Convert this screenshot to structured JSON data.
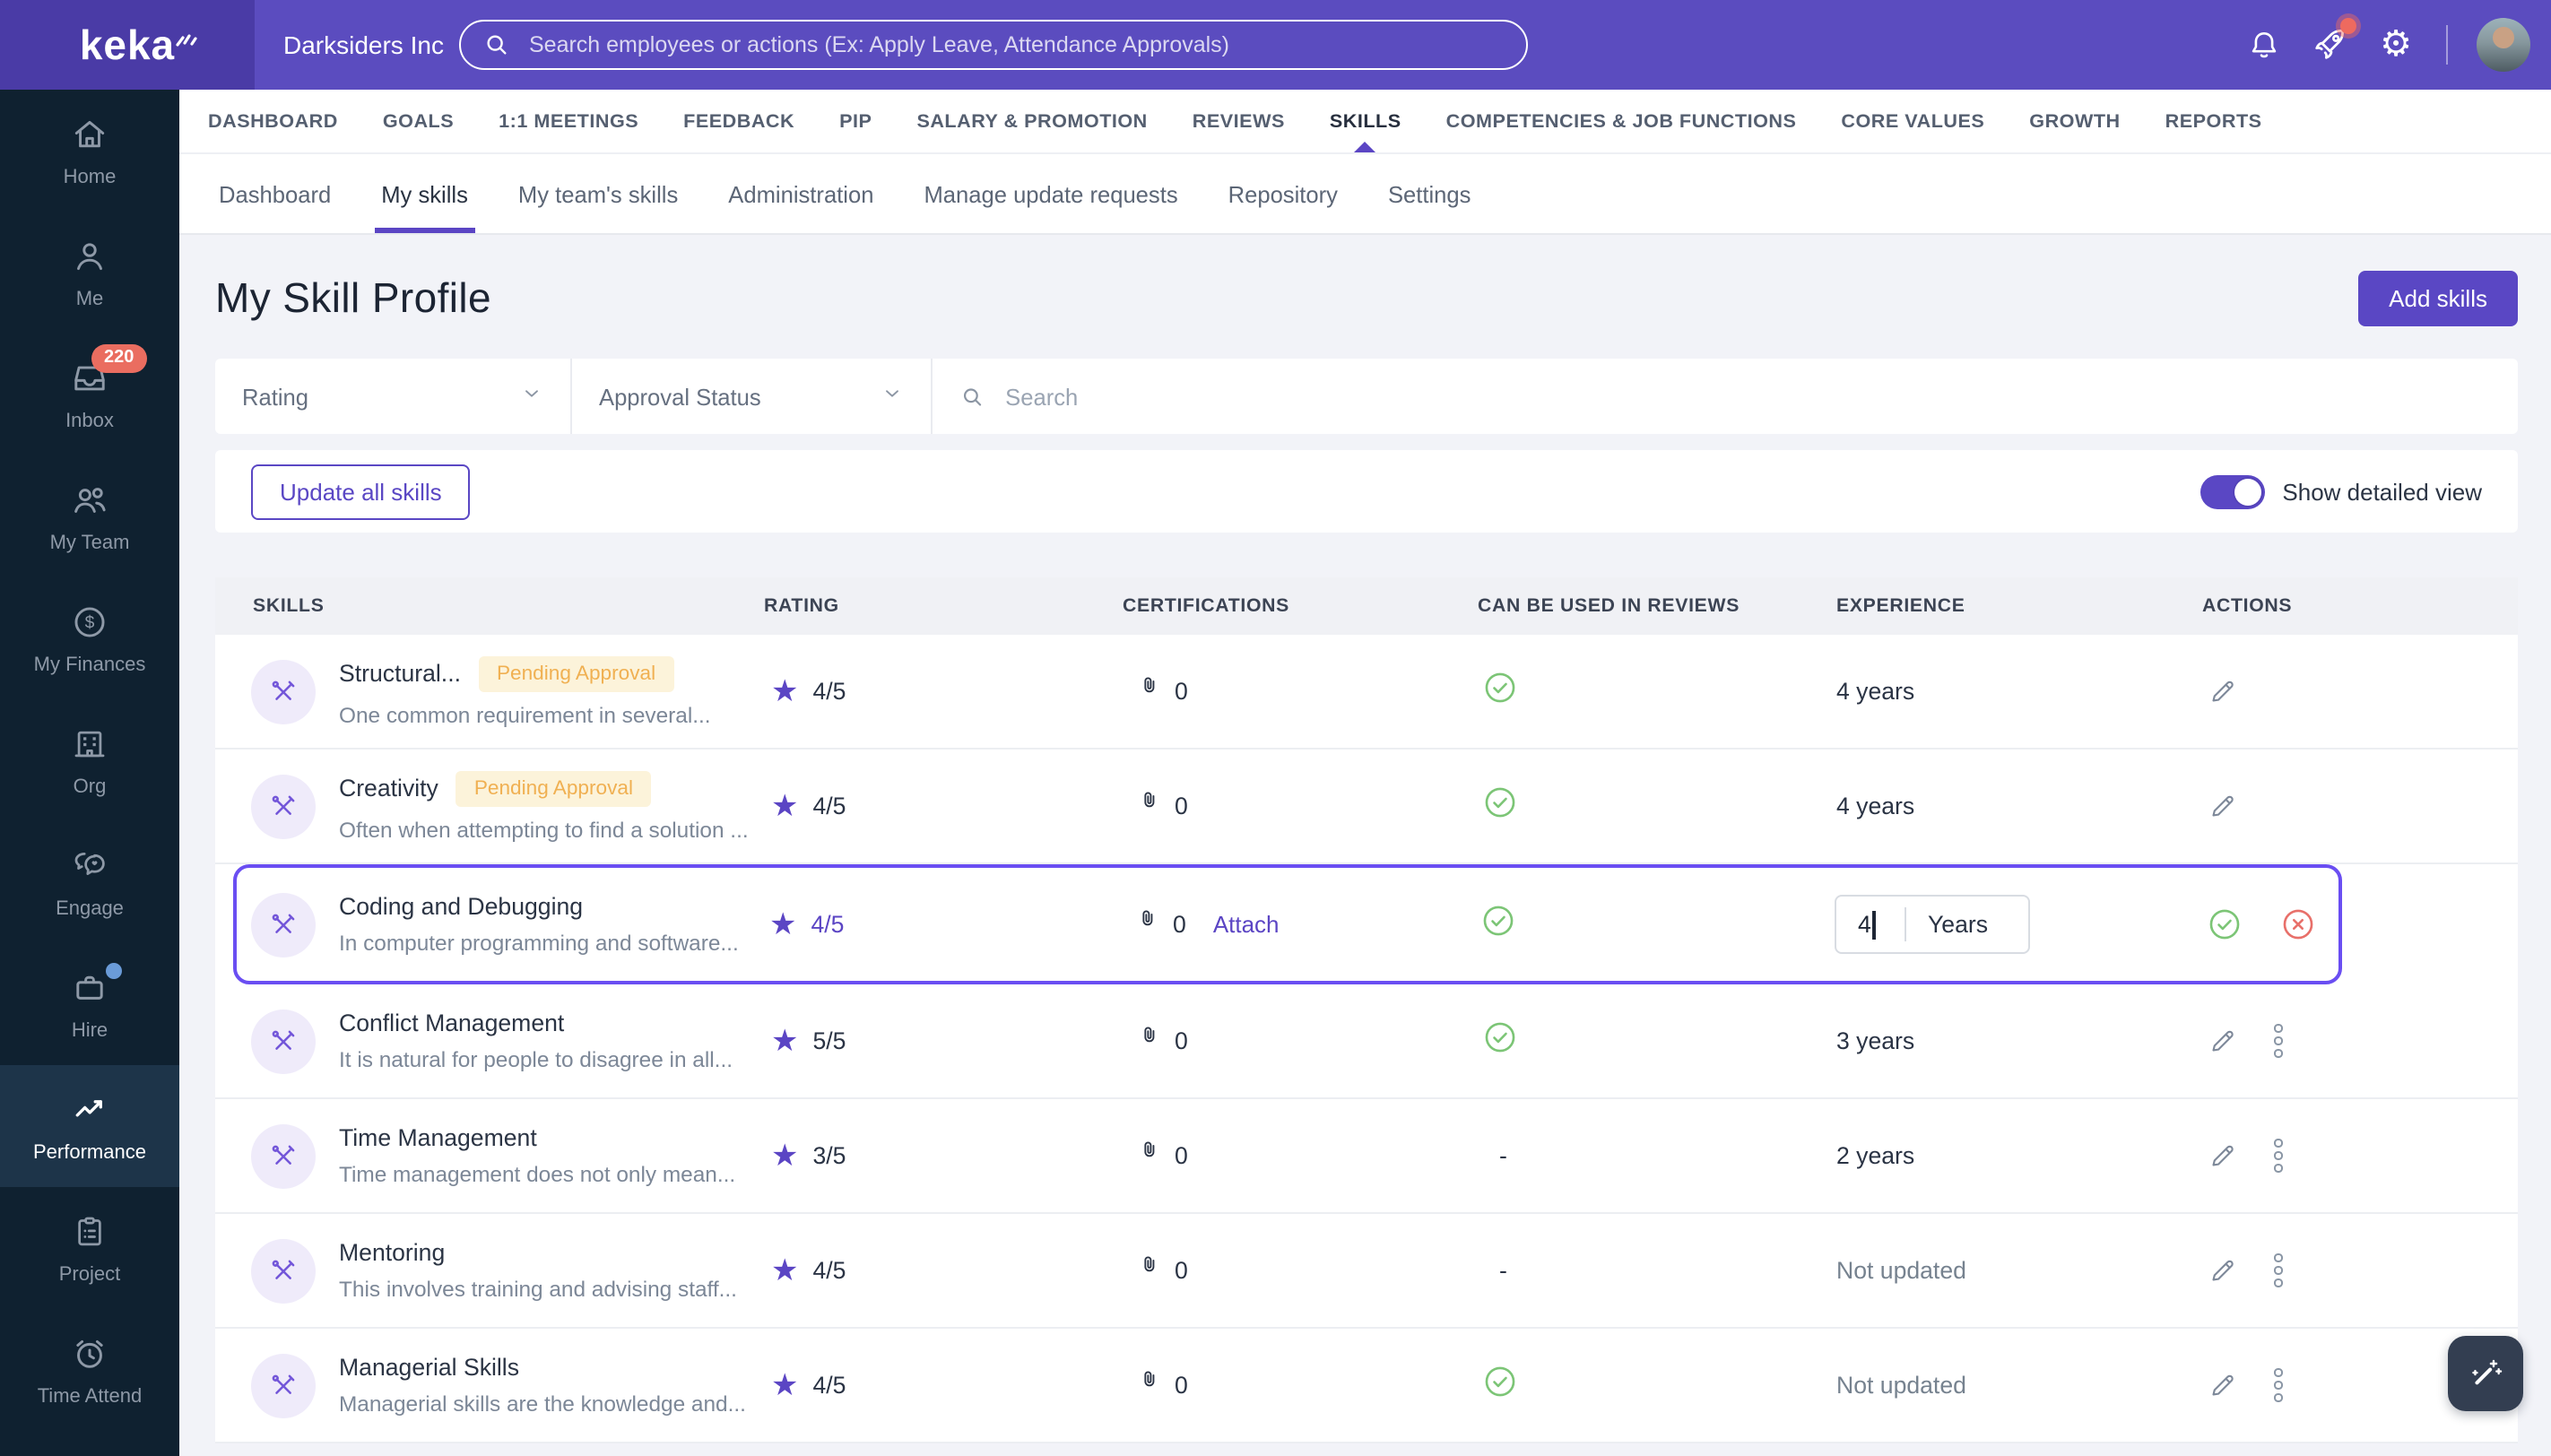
{
  "topbar": {
    "brand": "keka",
    "company": "Darksiders Inc",
    "search_placeholder": "Search employees or actions (Ex: Apply Leave, Attendance Approvals)"
  },
  "sidebar": {
    "items": [
      {
        "label": "Home",
        "icon": "home-icon",
        "active": false
      },
      {
        "label": "Me",
        "icon": "person-icon",
        "active": false
      },
      {
        "label": "Inbox",
        "icon": "inbox-icon",
        "active": false,
        "badge": "220"
      },
      {
        "label": "My Team",
        "icon": "team-icon",
        "active": false
      },
      {
        "label": "My Finances",
        "icon": "finance-icon",
        "active": false
      },
      {
        "label": "Org",
        "icon": "org-icon",
        "active": false
      },
      {
        "label": "Engage",
        "icon": "engage-icon",
        "active": false
      },
      {
        "label": "Hire",
        "icon": "briefcase-icon",
        "active": false,
        "dot": true
      },
      {
        "label": "Performance",
        "icon": "performance-icon",
        "active": true
      },
      {
        "label": "Project",
        "icon": "clipboard-icon",
        "active": false
      },
      {
        "label": "Time Attend",
        "icon": "clock-icon",
        "active": false
      }
    ]
  },
  "nav": {
    "tabs": [
      "DASHBOARD",
      "GOALS",
      "1:1 MEETINGS",
      "FEEDBACK",
      "PIP",
      "SALARY & PROMOTION",
      "REVIEWS",
      "SKILLS",
      "COMPETENCIES & JOB FUNCTIONS",
      "CORE VALUES",
      "GROWTH",
      "REPORTS"
    ],
    "active": "SKILLS"
  },
  "subnav": {
    "tabs": [
      "Dashboard",
      "My skills",
      "My team's skills",
      "Administration",
      "Manage update requests",
      "Repository",
      "Settings"
    ],
    "active": "My skills"
  },
  "page": {
    "title": "My Skill Profile",
    "add_button": "Add skills",
    "filters": {
      "rating": "Rating",
      "approval": "Approval Status",
      "search_placeholder": "Search"
    },
    "update_all": "Update all skills",
    "detailed_view": "Show detailed view"
  },
  "table": {
    "headers": [
      "SKILLS",
      "RATING",
      "CERTIFICATIONS",
      "CAN BE USED IN REVIEWS",
      "EXPERIENCE",
      "ACTIONS"
    ],
    "rows": [
      {
        "name": "Structural...",
        "badge": "Pending Approval",
        "description": "One common requirement in several...",
        "rating": "4/5",
        "certifications": "0",
        "reviews": "yes",
        "experience": "4 years",
        "actions": [
          "edit"
        ]
      },
      {
        "name": "Creativity",
        "badge": "Pending Approval",
        "description": "Often when attempting to find a solution ...",
        "rating": "4/5",
        "certifications": "0",
        "reviews": "yes",
        "experience": "4 years",
        "actions": [
          "edit"
        ]
      },
      {
        "name": "Coding and Debugging",
        "description": "In computer programming and software...",
        "rating": "4/5",
        "certifications": "0",
        "attach": "Attach",
        "reviews": "yes",
        "editing": true,
        "experience_value": "4",
        "experience_unit": "Years",
        "actions": [
          "confirm",
          "cancel"
        ]
      },
      {
        "name": "Conflict Management",
        "description": "It is natural for people to disagree in all...",
        "rating": "5/5",
        "certifications": "0",
        "reviews": "yes",
        "experience": "3 years",
        "actions": [
          "edit",
          "more"
        ]
      },
      {
        "name": "Time Management",
        "description": "Time management does not only mean...",
        "rating": "3/5",
        "certifications": "0",
        "reviews": "-",
        "experience": "2 years",
        "actions": [
          "edit",
          "more"
        ]
      },
      {
        "name": "Mentoring",
        "description": "This involves training and advising staff...",
        "rating": "4/5",
        "certifications": "0",
        "reviews": "-",
        "experience": "Not updated",
        "actions": [
          "edit",
          "more"
        ]
      },
      {
        "name": "Managerial Skills",
        "description": "Managerial skills are the knowledge and...",
        "rating": "4/5",
        "certifications": "0",
        "reviews": "yes",
        "experience": "Not updated",
        "actions": [
          "edit",
          "more"
        ]
      }
    ]
  },
  "icons": {
    "star": "★",
    "gear": "⚙"
  },
  "colors": {
    "brand_purple": "#5b4cbf",
    "brand_dark_purple": "#4a3ba6",
    "sidebar_bg": "#0f2130",
    "sidebar_active_bg": "#1d3449",
    "accent_purple": "#5a47c4",
    "highlight_border": "#6a4ef2",
    "pending_badge_bg": "#fcf3da",
    "pending_badge_text": "#f0b052",
    "notification_red": "#ea6d60",
    "hire_dot_blue": "#6a9bd8",
    "success_green": "#7cc576",
    "danger_red": "#e8706a"
  }
}
